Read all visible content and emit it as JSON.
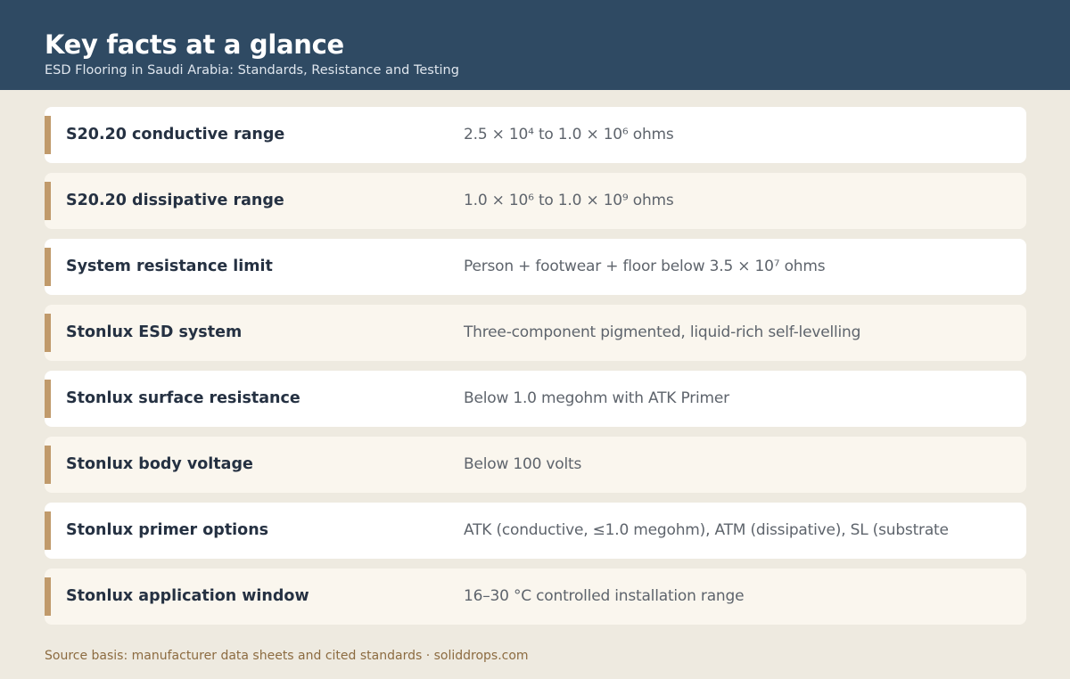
{
  "header": {
    "title": "Key facts at a glance",
    "subtitle": "ESD Flooring in Saudi Arabia: Standards, Resistance and Testing"
  },
  "facts": [
    {
      "label": "S20.20 conductive range",
      "value": "2.5 × 10⁴ to 1.0 × 10⁶ ohms"
    },
    {
      "label": "S20.20 dissipative range",
      "value": "1.0 × 10⁶ to 1.0 × 10⁹ ohms"
    },
    {
      "label": "System resistance limit",
      "value": "Person + footwear + floor below 3.5 × 10⁷ ohms"
    },
    {
      "label": "Stonlux ESD system",
      "value": "Three-component pigmented, liquid-rich self-levelling"
    },
    {
      "label": "Stonlux surface resistance",
      "value": "Below 1.0 megohm with ATK Primer"
    },
    {
      "label": "Stonlux body voltage",
      "value": "Below 100 volts"
    },
    {
      "label": "Stonlux primer options",
      "value": "ATK (conductive, ≤1.0 megohm), ATM (dissipative), SL (substrate"
    },
    {
      "label": "Stonlux application window",
      "value": "16–30 °C controlled installation range"
    }
  ],
  "footer": {
    "text": "Source basis: manufacturer data sheets and cited standards · soliddrops.com"
  },
  "colors": {
    "header_bg": "#2f4a63",
    "page_bg": "#eeeae0",
    "accent": "#c09a6b",
    "row_bg": "#ffffff",
    "row_alt_bg": "#faf6ee"
  }
}
